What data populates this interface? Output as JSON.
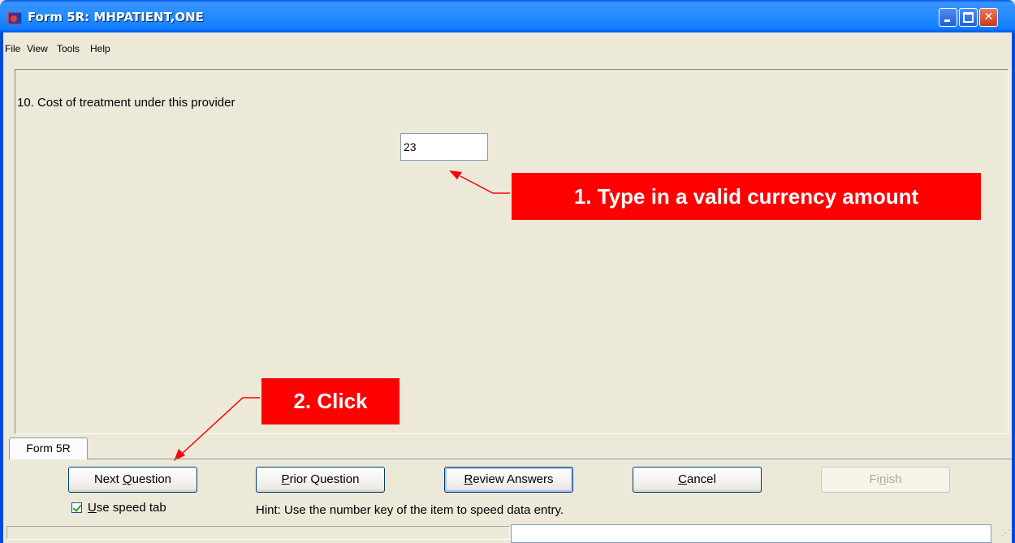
{
  "window": {
    "title": "Form 5R: MHPATIENT,ONE",
    "controls": {
      "minimize_icon": "minimize-icon",
      "maximize_icon": "maximize-icon",
      "close_icon": "close-icon"
    }
  },
  "menu": {
    "items": [
      "File",
      "View",
      "Tools",
      "Help"
    ]
  },
  "question": {
    "label": "10. Cost of treatment under this provider",
    "answer_value": "23"
  },
  "annotations": {
    "step1": "1. Type in a valid currency amount",
    "step2": "2. Click",
    "color": "#ff0000"
  },
  "tabs": [
    {
      "label": "Form 5R",
      "selected": true
    }
  ],
  "buttons": {
    "next": {
      "label": "Next Question",
      "underline": "Q"
    },
    "prior": {
      "label": "Prior Question",
      "underline": "P"
    },
    "review": {
      "label": "Review Answers",
      "underline": "R"
    },
    "cancel": {
      "label": "Cancel",
      "underline": "C"
    },
    "finish": {
      "label": "Finish",
      "underline": "n",
      "enabled": false
    }
  },
  "options": {
    "use_speed_tab_label": "Use speed tab",
    "use_speed_tab_checked": true
  },
  "hint": "Hint: Use the number key of the item to speed data entry.",
  "status": {
    "left": "",
    "right": ""
  }
}
